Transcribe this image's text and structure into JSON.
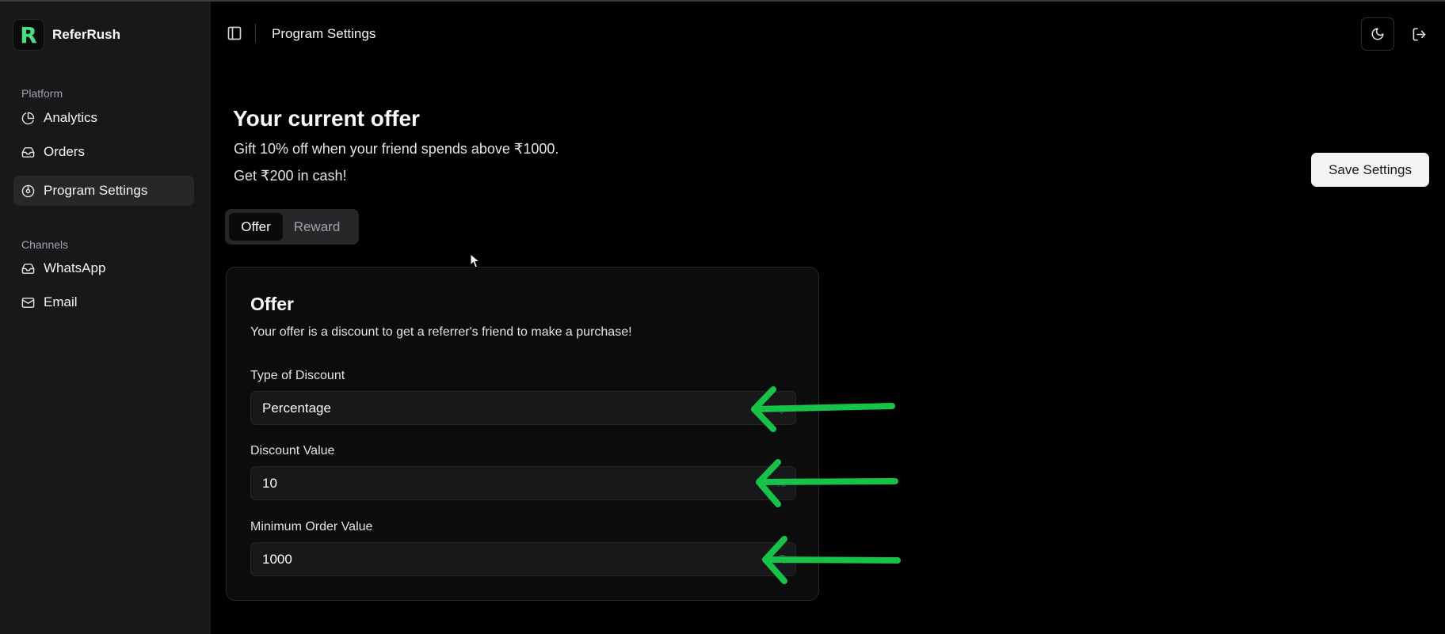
{
  "app": {
    "name": "ReferRush",
    "logo_letter": "R",
    "brand_color": "#4ade80"
  },
  "sidebar": {
    "groups": [
      {
        "label": "Platform",
        "items": [
          {
            "label": "Analytics",
            "icon": "pie-chart-icon"
          },
          {
            "label": "Orders",
            "icon": "inbox-icon"
          },
          {
            "label": "Program Settings",
            "icon": "settings-circle-icon",
            "active": true
          }
        ]
      },
      {
        "label": "Channels",
        "items": [
          {
            "label": "WhatsApp",
            "icon": "inbox-icon"
          },
          {
            "label": "Email",
            "icon": "mail-icon"
          }
        ]
      }
    ]
  },
  "header": {
    "title": "Program Settings",
    "icons": [
      "panel-left-icon",
      "moon-icon",
      "logout-icon"
    ]
  },
  "offer_summary": {
    "title": "Your current offer",
    "line1": "Gift 10% off when your friend spends above ₹1000.",
    "line2": "Get ₹200 in cash!"
  },
  "save_button": {
    "label": "Save Settings"
  },
  "tabs": [
    {
      "label": "Offer",
      "active": true
    },
    {
      "label": "Reward",
      "active": false
    }
  ],
  "card": {
    "title": "Offer",
    "description": "Your offer is a discount to get a referrer's friend to make a purchase!",
    "fields": [
      {
        "label": "Type of Discount",
        "value": "Percentage",
        "suffix": "◇"
      },
      {
        "label": "Discount Value",
        "value": "10",
        "suffix": "%"
      },
      {
        "label": "Minimum Order Value",
        "value": "1000",
        "suffix": "₹"
      }
    ]
  },
  "annotation_color": "#16c247"
}
